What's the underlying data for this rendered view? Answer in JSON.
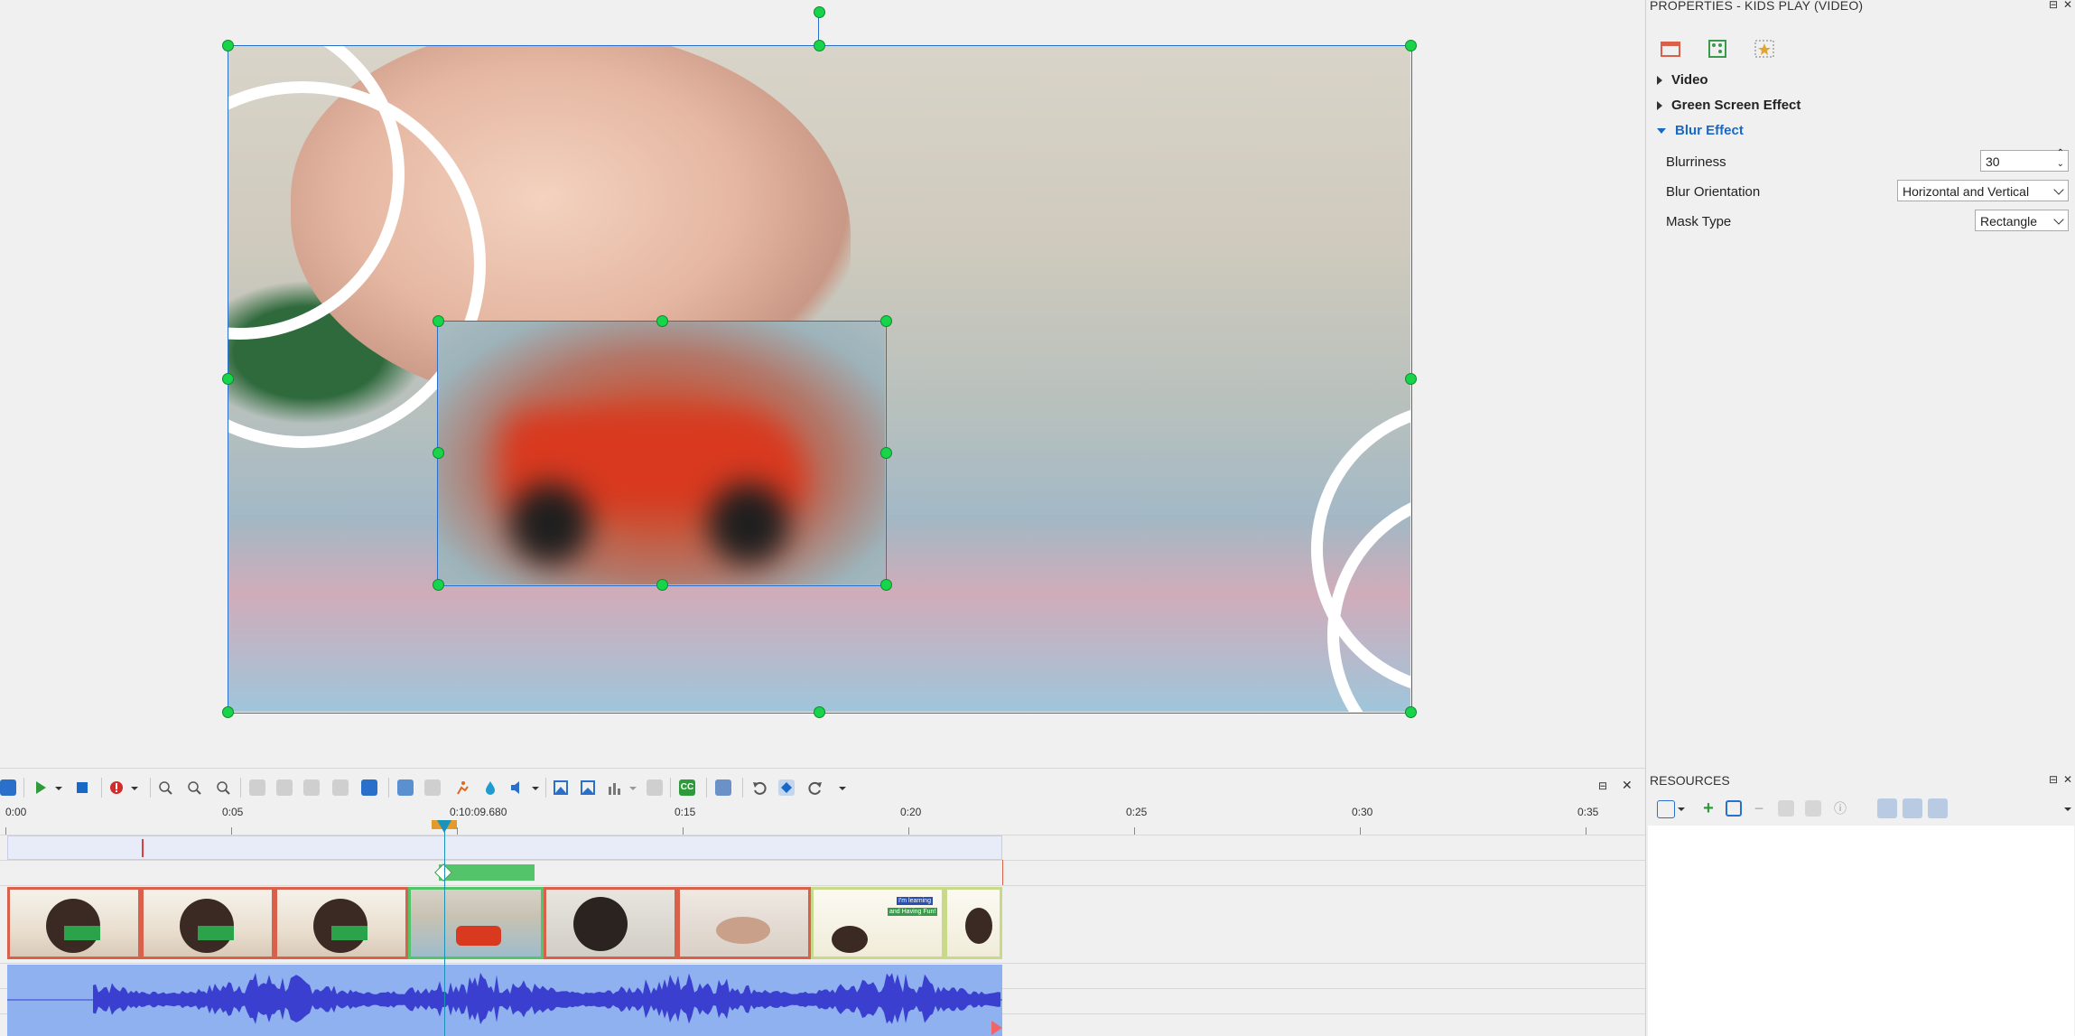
{
  "properties": {
    "title": "PROPERTIES - KIDS PLAY (VIDEO)",
    "tabs": [
      "video-tab-icon",
      "animation-tab-icon",
      "effects-tab-icon"
    ],
    "sections": [
      {
        "label": "Video",
        "expanded": false
      },
      {
        "label": "Green Screen Effect",
        "expanded": false
      },
      {
        "label": "Blur Effect",
        "expanded": true
      }
    ],
    "blur": {
      "blurriness_label": "Blurriness",
      "blurriness_value": "30",
      "orientation_label": "Blur Orientation",
      "orientation_value": "Horizontal and Vertical",
      "mask_label": "Mask Type",
      "mask_value": "Rectangle"
    }
  },
  "resources": {
    "title": "RESOURCES"
  },
  "timeline": {
    "playhead_time": "0:10:09.680",
    "ruler": [
      "0:00",
      "0:05",
      "0:15",
      "0:20",
      "0:25",
      "0:30",
      "0:35"
    ],
    "clip_caption_1": "I'm learning",
    "clip_caption_2": "and Having Fun!"
  },
  "colors": {
    "accent": "#1a68c6",
    "handle": "#18d44a",
    "selection": "#2a6fc9",
    "clip_border": "#d9604b",
    "audio_bg": "#8fb1ef",
    "waveform": "#3a3fd0"
  }
}
